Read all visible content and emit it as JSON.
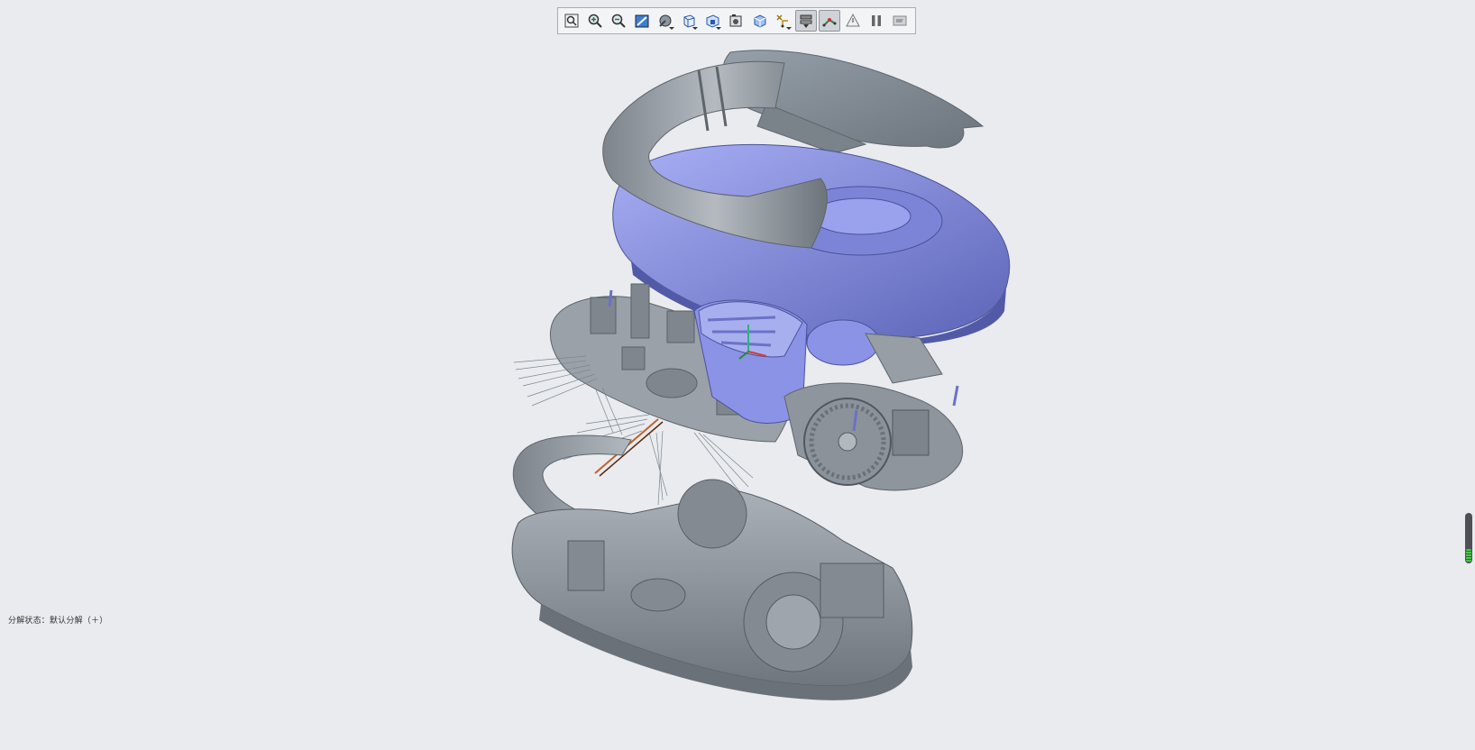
{
  "toolbar": {
    "buttons": [
      {
        "name": "zoom-fit-button",
        "icon": "zoom-fit-icon",
        "active": false,
        "dropdown": false
      },
      {
        "name": "zoom-in-button",
        "icon": "zoom-in-icon",
        "active": false,
        "dropdown": false
      },
      {
        "name": "zoom-out-button",
        "icon": "zoom-out-icon",
        "active": false,
        "dropdown": false
      },
      {
        "name": "repaint-button",
        "icon": "repaint-icon",
        "active": false,
        "dropdown": false
      },
      {
        "name": "display-style-button",
        "icon": "shading-icon",
        "active": false,
        "dropdown": true
      },
      {
        "name": "saved-orientations-button",
        "icon": "cube-view-icon",
        "active": false,
        "dropdown": true
      },
      {
        "name": "view-manager-button",
        "icon": "view-manager-icon",
        "active": false,
        "dropdown": true
      },
      {
        "name": "perspective-button",
        "icon": "camera-icon",
        "active": false,
        "dropdown": false
      },
      {
        "name": "section-button",
        "icon": "section-cube-icon",
        "active": false,
        "dropdown": false
      },
      {
        "name": "datum-display-button",
        "icon": "datum-axes-icon",
        "active": false,
        "dropdown": true
      },
      {
        "name": "explode-view-button",
        "icon": "explode-view-icon",
        "active": true,
        "dropdown": false
      },
      {
        "name": "edit-position-button",
        "icon": "edit-position-icon",
        "active": true,
        "dropdown": false
      },
      {
        "name": "annotations-button",
        "icon": "warning-triangle-icon",
        "active": false,
        "dropdown": false
      },
      {
        "name": "pause-button",
        "icon": "pause-icon",
        "active": false,
        "dropdown": false
      },
      {
        "name": "close-view-button",
        "icon": "flag-icon",
        "active": false,
        "dropdown": false
      }
    ]
  },
  "status": {
    "explode_state": "分解状态：默认分解（＋）"
  },
  "scroll_indicator": {
    "level": 0.25
  },
  "colors": {
    "background": "#e9ebee",
    "part_gray": "#8a9199",
    "part_blue": "#8c95e8"
  }
}
